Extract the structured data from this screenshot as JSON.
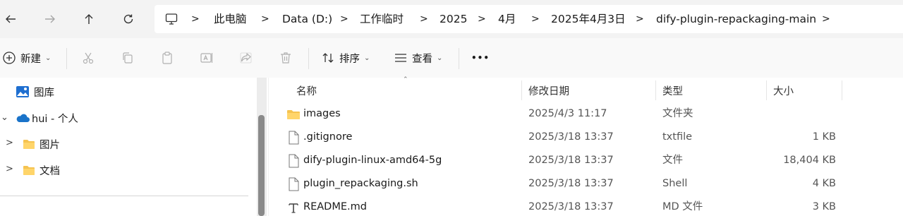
{
  "breadcrumb": {
    "items": [
      "此电脑",
      "Data (D:)",
      "工作临时",
      "2025",
      "4月",
      "2025年4月3日",
      "dify-plugin-repackaging-main"
    ]
  },
  "toolbar": {
    "new_label": "新建",
    "sort_label": "排序",
    "view_label": "查看",
    "more_label": "•••"
  },
  "nav": {
    "items": [
      {
        "label": "图库",
        "icon": "gallery-icon"
      },
      {
        "label": "hui - 个人",
        "icon": "onedrive-cloud-icon"
      },
      {
        "label": "图片",
        "icon": "folder-icon"
      },
      {
        "label": "文档",
        "icon": "folder-icon"
      }
    ]
  },
  "columns": {
    "name": "名称",
    "date": "修改日期",
    "type": "类型",
    "size": "大小"
  },
  "files": [
    {
      "name": "images",
      "date": "2025/4/3 11:17",
      "type": "文件夹",
      "size": "",
      "icon": "folder-icon"
    },
    {
      "name": ".gitignore",
      "date": "2025/3/18 13:37",
      "type": "txtfile",
      "size": "1 KB",
      "icon": "file-icon"
    },
    {
      "name": "dify-plugin-linux-amd64-5g",
      "date": "2025/3/18 13:37",
      "type": "文件",
      "size": "18,404 KB",
      "icon": "file-icon"
    },
    {
      "name": "plugin_repackaging.sh",
      "date": "2025/3/18 13:37",
      "type": "Shell",
      "size": "4 KB",
      "icon": "file-icon"
    },
    {
      "name": "README.md",
      "date": "2025/3/18 13:37",
      "type": "MD 文件",
      "size": "3 KB",
      "icon": "markdown-file-icon"
    }
  ],
  "colors": {
    "folder": "#f5c350",
    "onedrive": "#1a73c9",
    "toolbar_bg": "#f9f9f9",
    "addr_bg": "#f3f3f3"
  }
}
